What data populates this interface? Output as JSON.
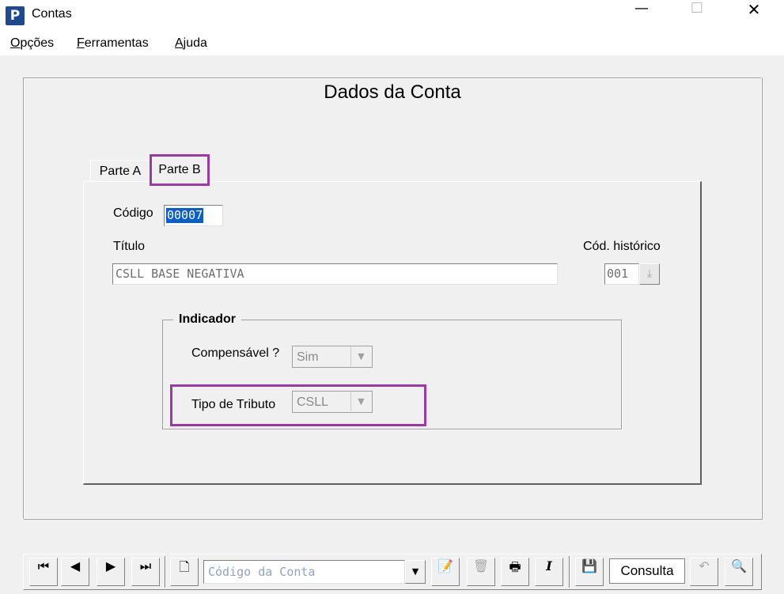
{
  "window": {
    "app_icon_letter": "P",
    "title": "Contas",
    "minimize_glyph": "—",
    "maximize_glyph": "☐",
    "close_glyph": "✕"
  },
  "menu": {
    "opcoes_mnemonic": "O",
    "opcoes_rest": "pções",
    "ferramentas_mnemonic": "F",
    "ferramentas_rest": "erramentas",
    "ajuda_mnemonic": "A",
    "ajuda_rest": "juda"
  },
  "form": {
    "title": "Dados da Conta",
    "tabs": [
      {
        "label": "Parte A",
        "active": false
      },
      {
        "label": "Parte B",
        "active": true
      }
    ],
    "codigo": {
      "label": "Código",
      "value": "00007"
    },
    "titulo": {
      "label": "Título",
      "value": "CSLL BASE NEGATIVA"
    },
    "cod_historico": {
      "label": "Cód. histórico",
      "value": "001"
    },
    "indicador": {
      "legend": "Indicador",
      "compensavel": {
        "label": "Compensável ?",
        "value": "Sim"
      },
      "tipo_tributo": {
        "label": "Tipo de Tributo",
        "value": "CSLL"
      }
    }
  },
  "toolbar": {
    "first": "⏮",
    "prev": "◀",
    "next": "▶",
    "last": "⏭",
    "new": "🗋",
    "search_placeholder": "Código da Conta",
    "search_drop": "▼",
    "edit": "📝",
    "delete": "🗑",
    "print": "🖶",
    "italic": "I",
    "save": "💾",
    "mode": "Consulta",
    "undo": "↶",
    "find": "🔍"
  },
  "colors": {
    "highlight": "#9b3aa6",
    "selection": "#0a5ec8"
  }
}
